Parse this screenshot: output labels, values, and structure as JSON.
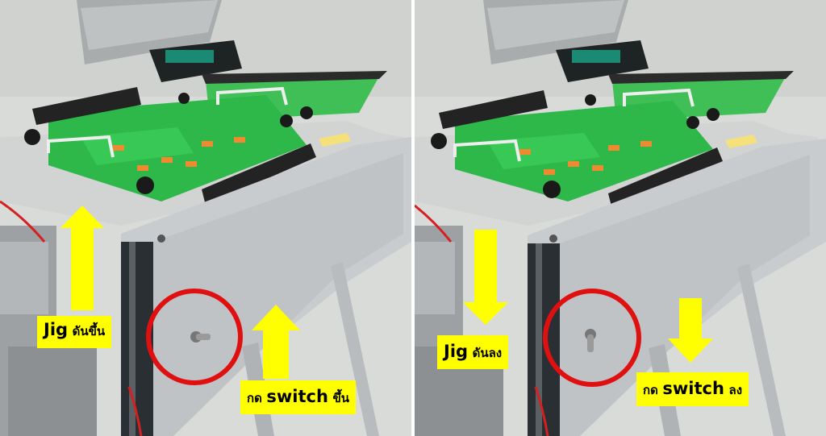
{
  "left_panel": {
    "caption_jig": {
      "word": "Jig",
      "action": "ดันขึ้น"
    },
    "caption_switch": {
      "prefix": "กด",
      "word": "switch",
      "action": "ขึ้น"
    },
    "arrow_direction": "up"
  },
  "right_panel": {
    "caption_jig": {
      "word": "Jig",
      "action": "ดันลง"
    },
    "caption_switch": {
      "prefix": "กด",
      "word": "switch",
      "action": "ลง"
    },
    "arrow_direction": "down"
  },
  "colors": {
    "arrow_yellow": "#ffff00",
    "highlight_red": "#e01010",
    "pcb_green": "#2eb84a",
    "frame_silver": "#c9cccf"
  }
}
